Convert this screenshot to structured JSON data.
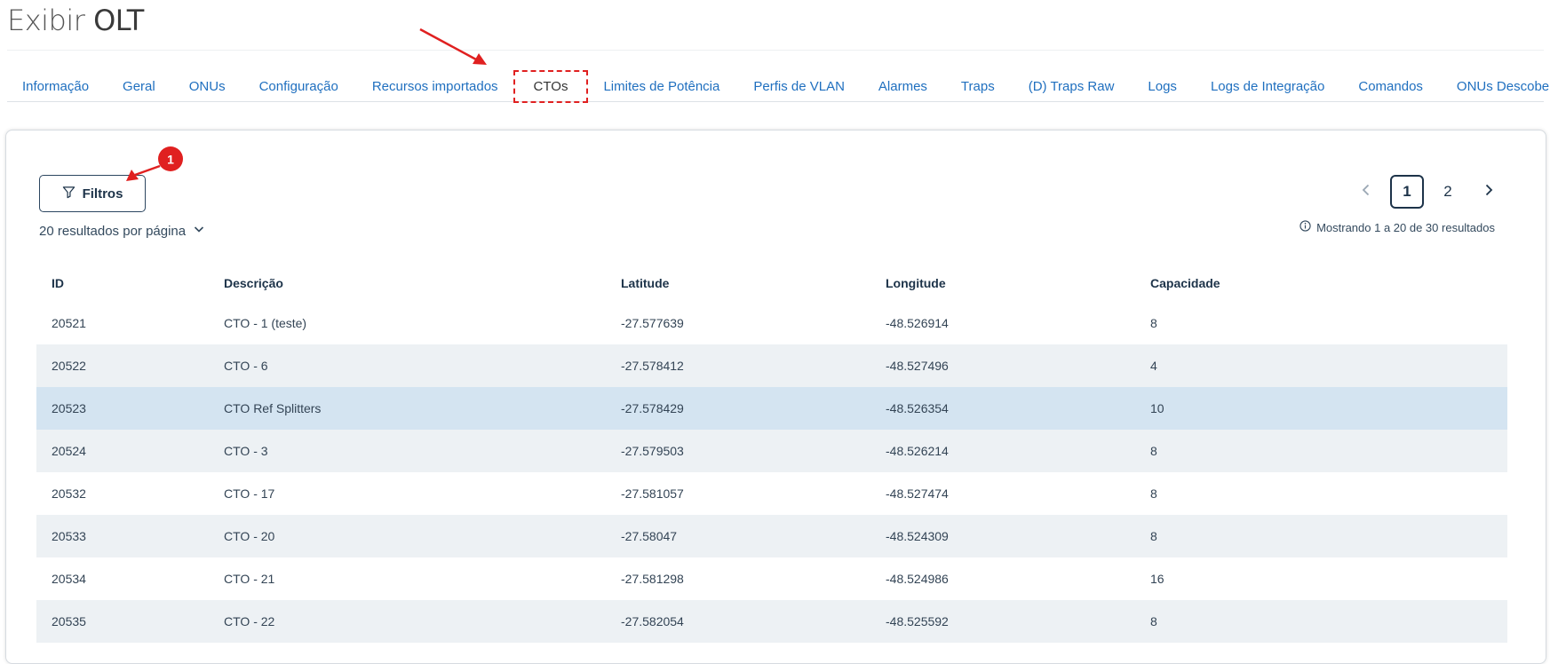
{
  "page": {
    "title_light": "Exibir",
    "title_bold": "OLT"
  },
  "tabs": [
    {
      "label": "Informação"
    },
    {
      "label": "Geral"
    },
    {
      "label": "ONUs"
    },
    {
      "label": "Configuração"
    },
    {
      "label": "Recursos importados"
    },
    {
      "label": "CTOs",
      "active": true
    },
    {
      "label": "Limites de Potência"
    },
    {
      "label": "Perfis de VLAN"
    },
    {
      "label": "Alarmes"
    },
    {
      "label": "Traps"
    },
    {
      "label": "(D) Traps Raw"
    },
    {
      "label": "Logs"
    },
    {
      "label": "Logs de Integração"
    },
    {
      "label": "Comandos"
    },
    {
      "label": "ONUs Descobertas"
    }
  ],
  "toolbar": {
    "filters_label": "Filtros",
    "per_page_label": "20 resultados por página"
  },
  "pagination": {
    "pages": [
      "1",
      "2"
    ],
    "current": "1",
    "summary": "Mostrando 1 a 20 de 30 resultados"
  },
  "annotation": {
    "badge_number": "1",
    "color": "#e02020"
  },
  "table": {
    "columns": [
      "ID",
      "Descrição",
      "Latitude",
      "Longitude",
      "Capacidade"
    ],
    "rows": [
      [
        "20521",
        "CTO - 1 (teste)",
        "-27.577639",
        "-48.526914",
        "8"
      ],
      [
        "20522",
        "CTO - 6",
        "-27.578412",
        "-48.527496",
        "4"
      ],
      [
        "20523",
        "CTO Ref Splitters",
        "-27.578429",
        "-48.526354",
        "10"
      ],
      [
        "20524",
        "CTO - 3",
        "-27.579503",
        "-48.526214",
        "8"
      ],
      [
        "20532",
        "CTO - 17",
        "-27.581057",
        "-48.527474",
        "8"
      ],
      [
        "20533",
        "CTO - 20",
        "-27.58047",
        "-48.524309",
        "8"
      ],
      [
        "20534",
        "CTO - 21",
        "-27.581298",
        "-48.524986",
        "16"
      ],
      [
        "20535",
        "CTO - 22",
        "-27.582054",
        "-48.525592",
        "8"
      ]
    ]
  },
  "colors": {
    "link": "#1f6fbf",
    "primary_dark": "#1d3349",
    "row_alt": "#edf1f4",
    "row_selected": "#d4e4f1"
  }
}
